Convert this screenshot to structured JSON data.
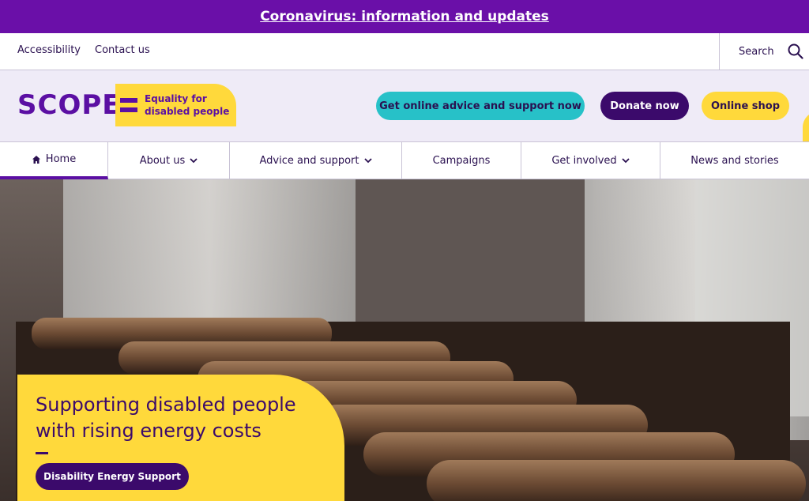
{
  "alert": {
    "text": "Coronavirus: information and updates"
  },
  "utility": {
    "links": [
      "Accessibility",
      "Contact us"
    ],
    "search_label": "Search"
  },
  "brand": {
    "logo_text": "SCOPE",
    "tagline": "Equality for disabled people"
  },
  "header_actions": {
    "advice": "Get online advice and support now",
    "donate": "Donate now",
    "shop": "Online shop"
  },
  "nav": {
    "items": [
      {
        "label": "Home",
        "icon": "home-icon",
        "active": true
      },
      {
        "label": "About us",
        "dropdown": true
      },
      {
        "label": "Advice and support",
        "dropdown": true
      },
      {
        "label": "Campaigns"
      },
      {
        "label": "Get involved",
        "dropdown": true
      },
      {
        "label": "News and stories"
      }
    ]
  },
  "hero": {
    "title": "Supporting disabled people with rising energy costs",
    "button": "Disability Energy Support"
  },
  "colors": {
    "purple": "#5b0fa3",
    "dark_purple": "#3b0a6b",
    "yellow": "#ffd93b",
    "teal": "#27c1c8",
    "banner": "#6a0fa8"
  }
}
